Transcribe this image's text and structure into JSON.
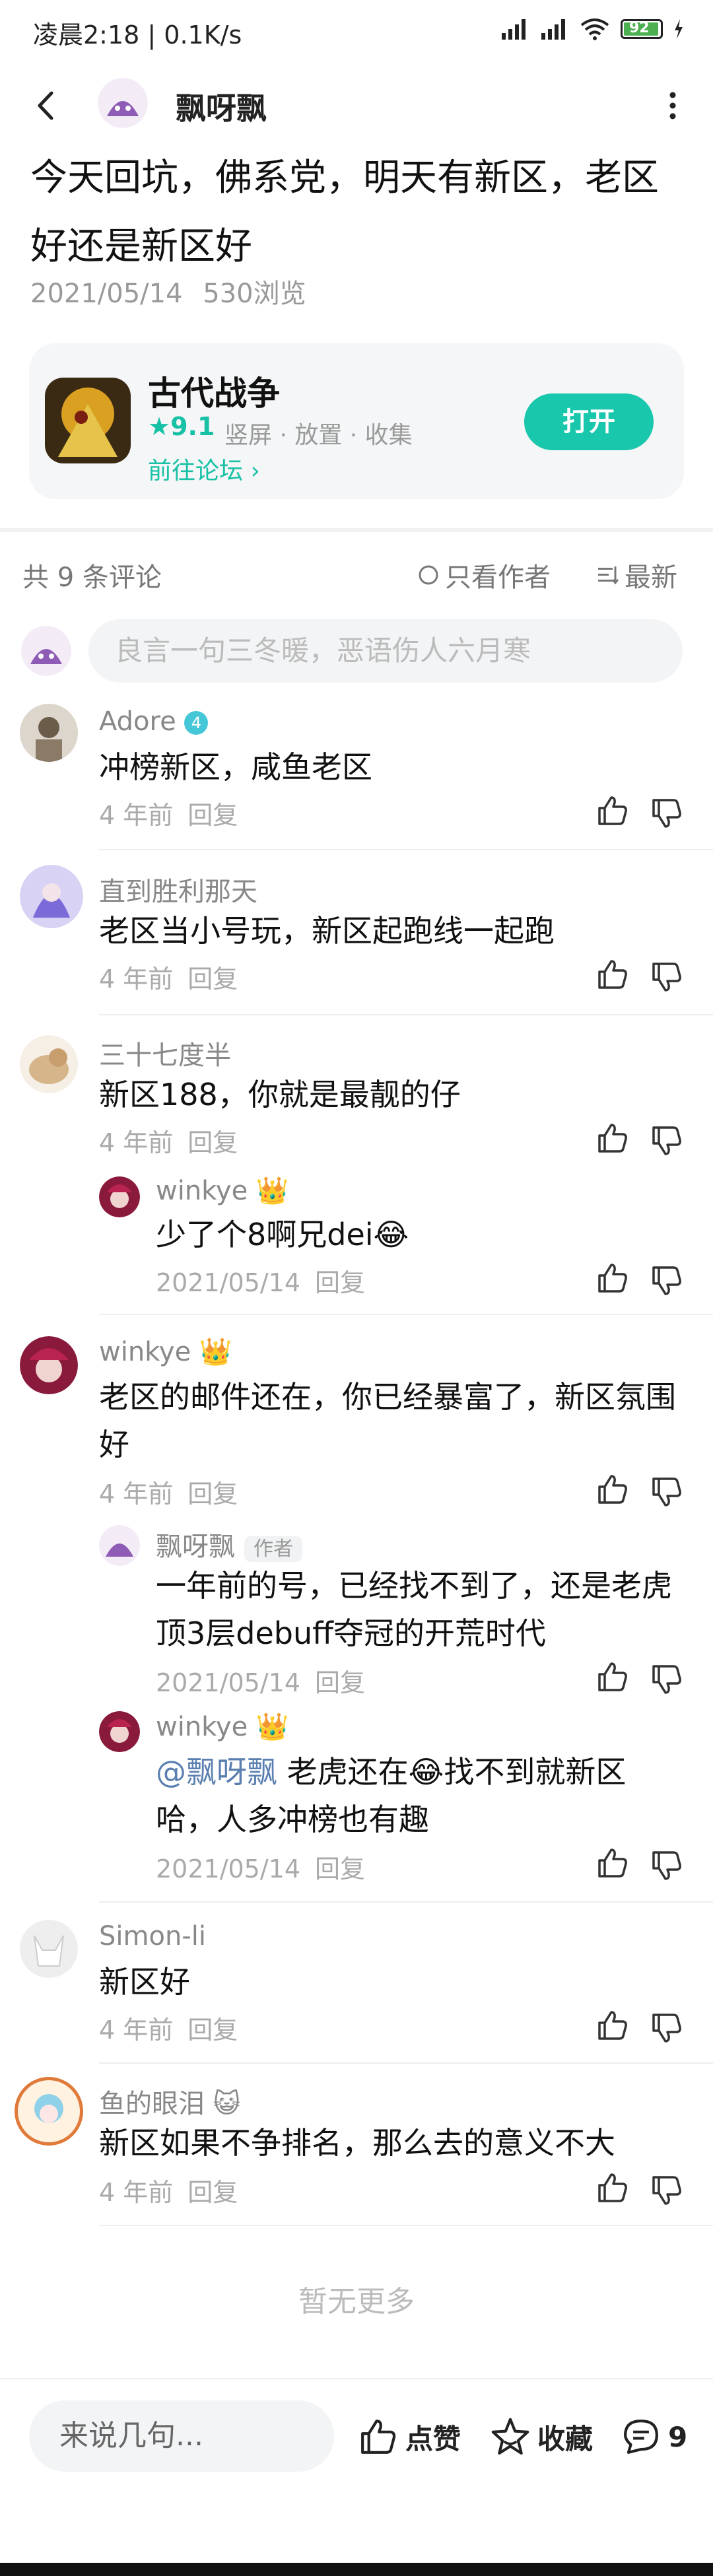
{
  "status_bar": {
    "time": "凌晨2:18 | 0.1K/s",
    "battery": "92"
  },
  "header": {
    "username": "飘呀飘"
  },
  "post": {
    "title": "今天回坑，佛系党，明天有新区，老区好还是新区好",
    "date": "2021/05/14",
    "views": "530浏览"
  },
  "game": {
    "name": "古代战争",
    "score": "9.1",
    "tags": "竖屏 · 放置 · 收集",
    "link": "前往论坛",
    "open": "打开"
  },
  "comments_header": {
    "count": "共 9 条评论",
    "only_author": "只看作者",
    "latest": "最新",
    "input_placeholder": "良言一句三冬暖，恶语伤人六月寒"
  },
  "comments": [
    {
      "name": "Adore",
      "text": "冲榜新区，咸鱼老区",
      "time": "4 年前",
      "reply": "回复"
    },
    {
      "name": "直到胜利那天",
      "text": "老区当小号玩，新区起跑线一起跑",
      "time": "4 年前",
      "reply": "回复"
    },
    {
      "name": "三十七度半",
      "text": "新区188，你就是最靓的仔",
      "time": "4 年前",
      "reply": "回复",
      "replies": [
        {
          "name": "winkye",
          "text": "少了个8啊兄dei😂",
          "time": "2021/05/14",
          "reply": "回复"
        }
      ]
    },
    {
      "name": "winkye",
      "text": "老区的邮件还在，你已经暴富了，新区氛围好",
      "time": "4 年前",
      "reply": "回复",
      "replies": [
        {
          "name": "飘呀飘",
          "badge": "作者",
          "text": "一年前的号，已经找不到了，还是老虎顶3层debuff夺冠的开荒时代",
          "time": "2021/05/14",
          "reply": "回复"
        },
        {
          "name": "winkye",
          "mention": "@飘呀飘",
          "text": " 老虎还在😂找不到就新区哈，人多冲榜也有趣",
          "time": "2021/05/14",
          "reply": "回复"
        }
      ]
    },
    {
      "name": "Simon-li",
      "text": "新区好",
      "time": "4 年前",
      "reply": "回复"
    },
    {
      "name": "鱼的眼泪",
      "text": "新区如果不争排名，那么去的意义不大",
      "time": "4 年前",
      "reply": "回复"
    }
  ],
  "footer": {
    "no_more": "暂无更多",
    "input_placeholder": "来说几句...",
    "like": "点赞",
    "favorite": "收藏",
    "comment_count": "9"
  },
  "colors": {
    "accent": "#19c7ac",
    "text": "#111111",
    "muted": "#999999"
  }
}
